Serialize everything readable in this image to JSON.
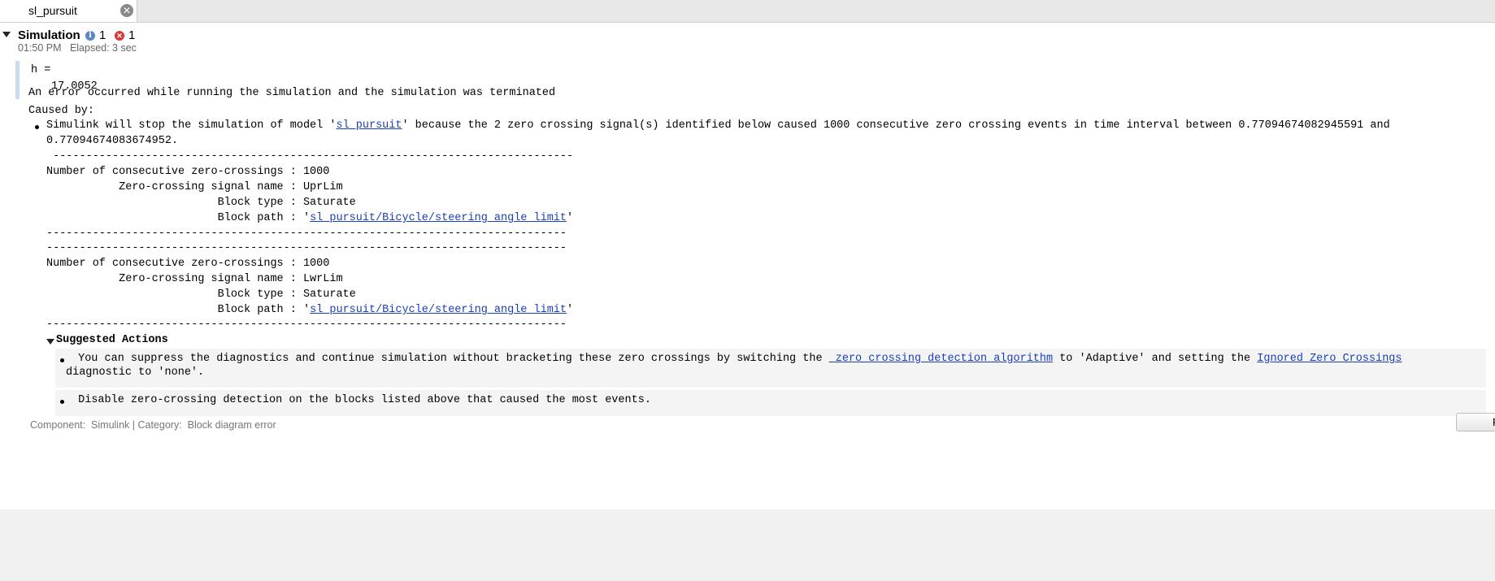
{
  "tab": {
    "title": "sl_pursuit",
    "close_glyph": "✕"
  },
  "simulation": {
    "title": "Simulation",
    "info_count": "1",
    "error_count": "1",
    "time": "01:50 PM",
    "elapsed": "Elapsed: 3 sec"
  },
  "output": {
    "var_line": "h =",
    "value": "17.0052"
  },
  "error": {
    "headline": "An error occurred while running the simulation and the simulation was terminated",
    "caused_by": "Caused by:",
    "message_pre": "Simulink will stop the simulation of model '",
    "model_link": "sl_pursuit",
    "message_post": "' because the 2 zero crossing signal(s) identified below caused 1000 consecutive zero crossing events in time interval between 0.77094674082945591 and",
    "message_line2": "0.77094674083674952.",
    "sep_indented": " -------------------------------------------------------------------------------",
    "separator": "-------------------------------------------------------------------------------",
    "signals": [
      {
        "num_label": "Number of consecutive zero-crossings : ",
        "num_value": "1000",
        "name_label": "           Zero-crossing signal name : ",
        "name_value": "UprLim",
        "type_label": "                          Block type : ",
        "type_value": "Saturate",
        "path_label": "                          Block path : '",
        "path_link": "sl_pursuit/Bicycle/steering angle limit",
        "path_end": "'"
      },
      {
        "num_label": "Number of consecutive zero-crossings : ",
        "num_value": "1000",
        "name_label": "           Zero-crossing signal name : ",
        "name_value": "LwrLim",
        "type_label": "                          Block type : ",
        "type_value": "Saturate",
        "path_label": "                          Block path : '",
        "path_link": "sl_pursuit/Bicycle/steering angle limit",
        "path_end": "'"
      }
    ],
    "suggested_title": "Suggested Actions",
    "actions": [
      {
        "pre": " You can suppress the diagnostics and continue simulation without bracketing these zero crossings by switching the ",
        "link1": " zero crossing detection algorithm",
        "mid": " to 'Adaptive' and setting the ",
        "link2": "Ignored Zero Crossings",
        "line2": "diagnostic to 'none'.",
        "button": "Fix"
      },
      {
        "text": " Disable zero-crossing detection on the blocks listed above that caused the most events."
      }
    ],
    "footer": "Component:  Simulink | Category:  Block diagram error"
  }
}
